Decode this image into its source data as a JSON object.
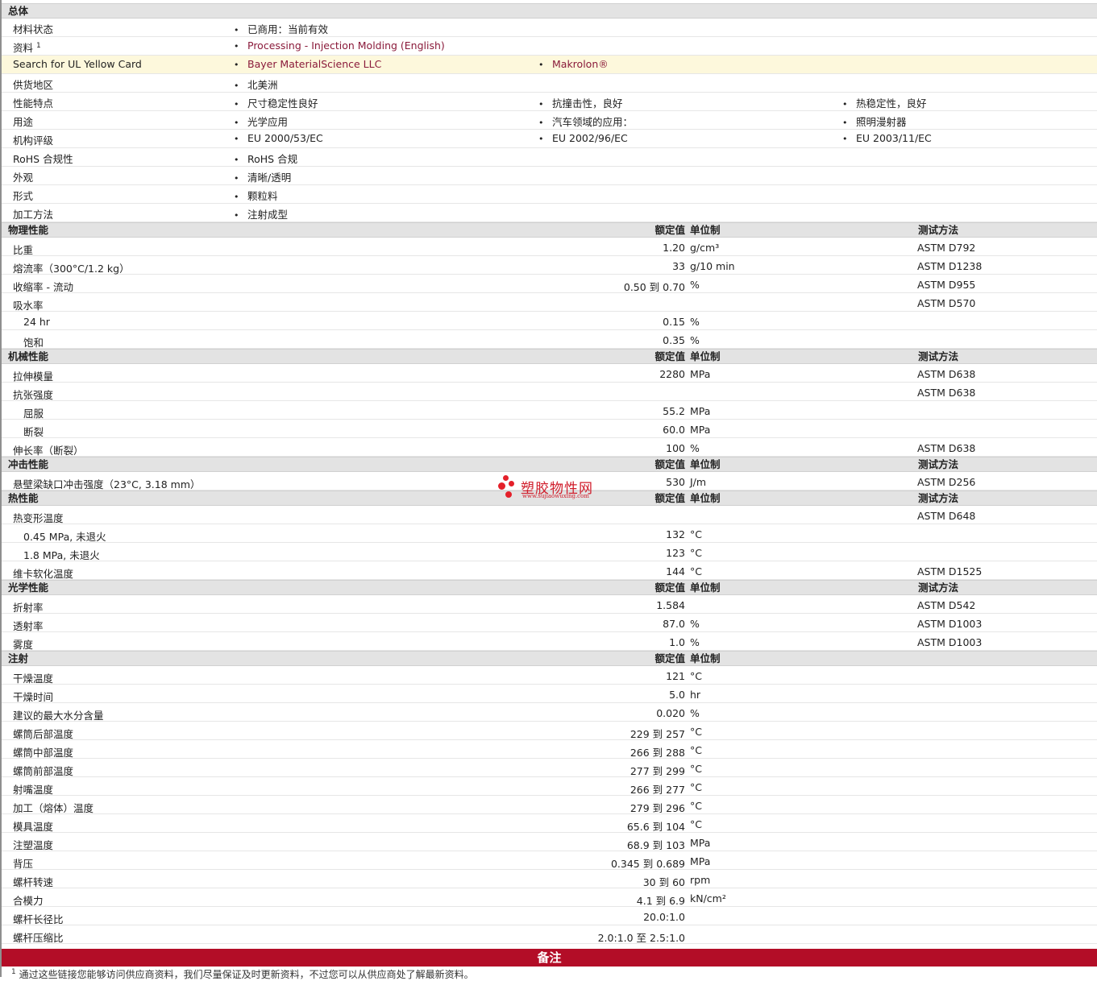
{
  "general": {
    "header": "总体",
    "rows": [
      {
        "label": "材料状态",
        "items": [
          "已商用：当前有效"
        ]
      },
      {
        "label": "资料",
        "label_sup": "1",
        "items": [
          "Processing - Injection Molding (English)"
        ],
        "link": true
      },
      {
        "label": "Search for UL Yellow Card",
        "items": [
          "Bayer MaterialScience LLC",
          "Makrolon®"
        ],
        "link": true,
        "highlight": true
      },
      {
        "label": "供货地区",
        "items": [
          "北美洲"
        ]
      },
      {
        "label": "性能特点",
        "items": [
          "尺寸稳定性良好",
          "抗撞击性，良好",
          "热稳定性，良好"
        ]
      },
      {
        "label": "用途",
        "items": [
          "光学应用",
          "汽车领域的应用：",
          "照明漫射器"
        ]
      },
      {
        "label": "机构评级",
        "items": [
          "EU 2000/53/EC",
          "EU 2002/96/EC",
          "EU 2003/11/EC"
        ]
      },
      {
        "label": "RoHS 合规性",
        "items": [
          "RoHS 合规"
        ]
      },
      {
        "label": "外观",
        "items": [
          "清晰/透明"
        ]
      },
      {
        "label": "形式",
        "items": [
          "颗粒料"
        ]
      },
      {
        "label": "加工方法",
        "items": [
          "注射成型"
        ]
      }
    ]
  },
  "columns": {
    "value": "额定值",
    "unit": "单位制",
    "method": "测试方法"
  },
  "sections": [
    {
      "title": "物理性能",
      "show_method": true,
      "rows": [
        {
          "label": "比重",
          "value": "1.20",
          "unit": "g/cm³",
          "method": "ASTM D792"
        },
        {
          "label": "熔流率（300°C/1.2 kg）",
          "value": "33",
          "unit": "g/10 min",
          "method": "ASTM D1238"
        },
        {
          "label": "收缩率 - 流动",
          "value": "0.50 到 0.70",
          "unit": "%",
          "method": "ASTM D955"
        },
        {
          "label": "吸水率",
          "value": "",
          "unit": "",
          "method": "ASTM D570"
        },
        {
          "label": "24 hr",
          "indent": true,
          "value": "0.15",
          "unit": "%",
          "method": ""
        },
        {
          "label": "饱和",
          "indent": true,
          "value": "0.35",
          "unit": "%",
          "method": ""
        }
      ]
    },
    {
      "title": "机械性能",
      "show_method": true,
      "rows": [
        {
          "label": "拉伸模量",
          "value": "2280",
          "unit": "MPa",
          "method": "ASTM D638"
        },
        {
          "label": "抗张强度",
          "value": "",
          "unit": "",
          "method": "ASTM D638"
        },
        {
          "label": "屈服",
          "indent": true,
          "value": "55.2",
          "unit": "MPa",
          "method": ""
        },
        {
          "label": "断裂",
          "indent": true,
          "value": "60.0",
          "unit": "MPa",
          "method": ""
        },
        {
          "label": "伸长率（断裂）",
          "value": "100",
          "unit": "%",
          "method": "ASTM D638"
        }
      ]
    },
    {
      "title": "冲击性能",
      "show_method": true,
      "rows": [
        {
          "label": "悬壁梁缺口冲击强度（23°C, 3.18 mm）",
          "value": "530",
          "unit": "J/m",
          "method": "ASTM D256"
        }
      ]
    },
    {
      "title": "热性能",
      "show_method": true,
      "rows": [
        {
          "label": "热变形温度",
          "value": "",
          "unit": "",
          "method": "ASTM D648"
        },
        {
          "label": "0.45 MPa, 未退火",
          "indent": true,
          "value": "132",
          "unit": "°C",
          "method": ""
        },
        {
          "label": "1.8 MPa, 未退火",
          "indent": true,
          "value": "123",
          "unit": "°C",
          "method": ""
        },
        {
          "label": "维卡软化温度",
          "value": "144",
          "unit": "°C",
          "method": "ASTM D1525"
        }
      ]
    },
    {
      "title": "光学性能",
      "show_method": true,
      "rows": [
        {
          "label": "折射率",
          "value": "1.584",
          "unit": "",
          "method": "ASTM D542"
        },
        {
          "label": "透射率",
          "value": "87.0",
          "unit": "%",
          "method": "ASTM D1003"
        },
        {
          "label": "雾度",
          "value": "1.0",
          "unit": "%",
          "method": "ASTM D1003"
        }
      ]
    },
    {
      "title": "注射",
      "show_method": false,
      "rows": [
        {
          "label": "干燥温度",
          "value": "121",
          "unit": "°C",
          "method": ""
        },
        {
          "label": "干燥时间",
          "value": "5.0",
          "unit": "hr",
          "method": ""
        },
        {
          "label": "建议的最大水分含量",
          "value": "0.020",
          "unit": "%",
          "method": ""
        },
        {
          "label": "螺筒后部温度",
          "value": "229 到 257",
          "unit": "°C",
          "method": ""
        },
        {
          "label": "螺筒中部温度",
          "value": "266 到 288",
          "unit": "°C",
          "method": ""
        },
        {
          "label": "螺筒前部温度",
          "value": "277 到 299",
          "unit": "°C",
          "method": ""
        },
        {
          "label": "射嘴温度",
          "value": "266 到 277",
          "unit": "°C",
          "method": ""
        },
        {
          "label": "加工（熔体）温度",
          "value": "279 到 296",
          "unit": "°C",
          "method": ""
        },
        {
          "label": "模具温度",
          "value": "65.6 到 104",
          "unit": "°C",
          "method": ""
        },
        {
          "label": "注塑温度",
          "value": "68.9 到 103",
          "unit": "MPa",
          "method": ""
        },
        {
          "label": "背压",
          "value": "0.345 到 0.689",
          "unit": "MPa",
          "method": ""
        },
        {
          "label": "螺杆转速",
          "value": "30 到 60",
          "unit": "rpm",
          "method": ""
        },
        {
          "label": "合模力",
          "value": "4.1 到 6.9",
          "unit": "kN/cm²",
          "method": ""
        },
        {
          "label": "螺杆长径比",
          "value": "20.0:1.0",
          "unit": "",
          "method": ""
        },
        {
          "label": "螺杆压缩比",
          "value": "2.0:1.0 至 2.5:1.0",
          "unit": "",
          "method": ""
        }
      ]
    }
  ],
  "notes": {
    "title": "备注",
    "footnote_num": "1",
    "footnote": "通过这些链接您能够访问供应商资料，我们尽量保证及时更新资料，不过您可以从供应商处了解最新资料。"
  },
  "watermark": {
    "text": "塑胶物性网",
    "url": "www.sujiaowuxing.com"
  },
  "colors": {
    "section_bg": "#e3e3e3",
    "highlight_row": "#fdf8dc",
    "link": "#8a1a3a",
    "notes_bar": "#b30d27",
    "watermark": "#e4202a"
  }
}
